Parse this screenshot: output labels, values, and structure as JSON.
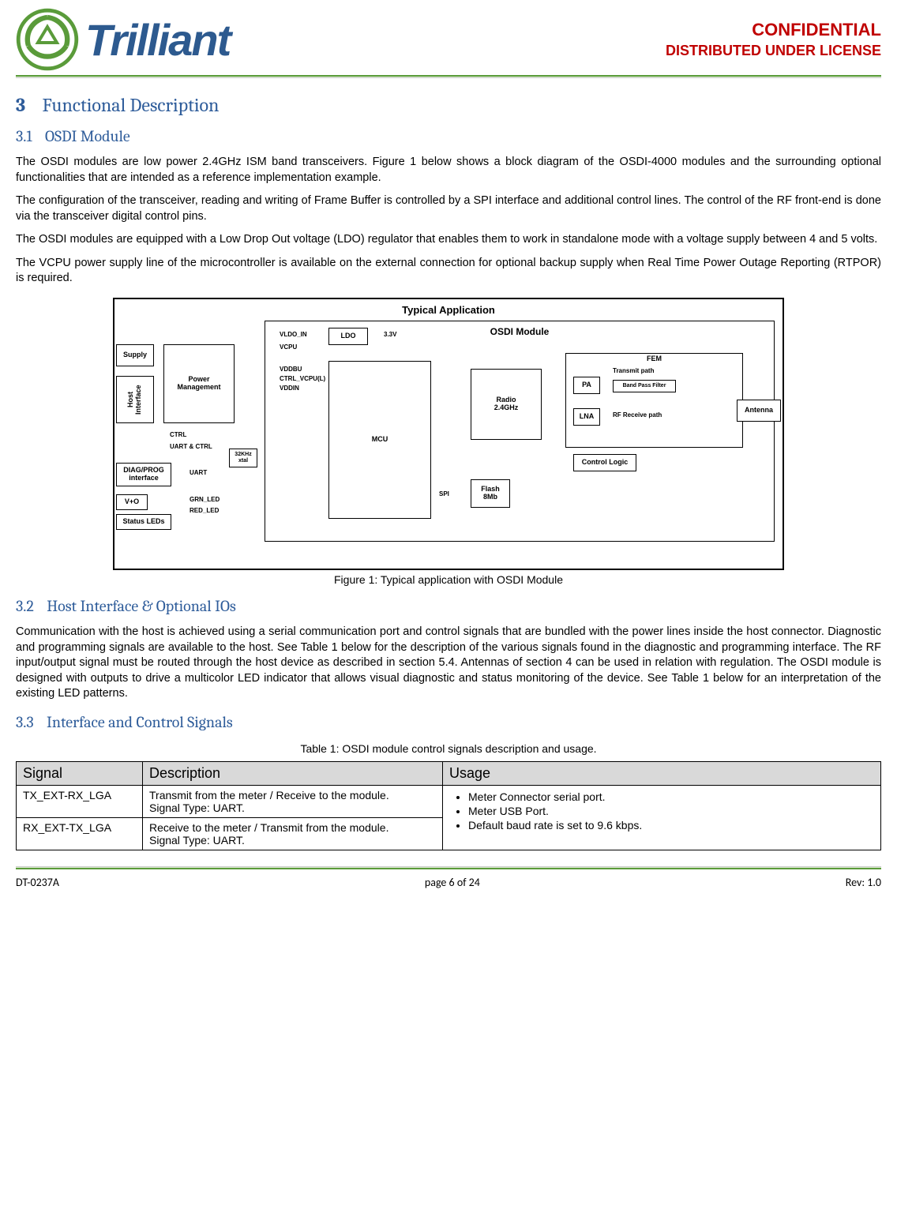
{
  "header": {
    "logo_text": "Trilliant",
    "classification_line1": "CONFIDENTIAL",
    "classification_line2": "DISTRIBUTED UNDER LICENSE"
  },
  "section3": {
    "num": "3",
    "title": "Functional Description"
  },
  "section3_1": {
    "num": "3.1",
    "title": "OSDI Module",
    "para1": "The OSDI modules are low power 2.4GHz ISM band transceivers. Figure 1 below shows a block diagram of the OSDI-4000 modules and the surrounding optional functionalities that are intended as a reference implementation example.",
    "para2": "The configuration of the transceiver, reading and writing of Frame Buffer is controlled by a SPI interface and additional control lines. The control of the RF front-end is done via the transceiver digital control pins.",
    "para3": "The OSDI modules are equipped with a Low Drop Out voltage (LDO) regulator that enables them to work in standalone mode with a voltage supply between 4 and 5 volts.",
    "para4": "The VCPU power supply line of the microcontroller is available on the external connection for optional backup supply when Real Time Power Outage Reporting (RTPOR) is required."
  },
  "figure1": {
    "outer_title": "Typical Application",
    "inner_title": "OSDI Module",
    "caption": "Figure 1: Typical application with OSDI Module",
    "blocks": {
      "supply": "Supply",
      "host_if": "Host Interface",
      "pm": "Power\nManagement",
      "diag": "DIAG/PROG\ninterface",
      "vplus": "V+O",
      "leds": "Status LEDs",
      "ldo": "LDO",
      "mcu": "MCU",
      "xtal": "32KHz\nxtal",
      "radio": "Radio\n2.4GHz",
      "flash": "Flash\n8Mb",
      "fem": "FEM",
      "pa": "PA",
      "lna": "LNA",
      "ctrl_logic": "Control Logic",
      "bpf": "Band Pass Filter",
      "tx_path": "Transmit path",
      "rx_path": "RF Receive path",
      "antenna": "Antenna"
    },
    "labels": {
      "vldo_in": "VLDO_IN",
      "vcpu": "VCPU",
      "vddbu": "VDDBU",
      "ctrl_vcpu": "CTRL_VCPU(L)",
      "vddin": "VDDIN",
      "ctrl": "CTRL",
      "uart_ctrl": "UART & CTRL",
      "uart": "UART",
      "grn": "GRN_LED",
      "red": "RED_LED",
      "spi": "SPI",
      "v3_3": "3.3V"
    }
  },
  "section3_2": {
    "num": "3.2",
    "title": "Host Interface & Optional IOs",
    "para1": "Communication with the host is achieved using a serial communication port and control signals that are bundled with the power lines inside the host connector. Diagnostic and programming signals are available to the host.  See Table 1 below for the description of the various signals found in the diagnostic and programming interface.  The RF input/output signal must be routed through the host device as described in section 5.4.  Antennas of section 4 can be used in relation with regulation.   The OSDI module is designed with outputs to drive a multicolor LED indicator that allows visual diagnostic and status monitoring of the device. See Table 1 below for an interpretation of the existing LED patterns."
  },
  "section3_3": {
    "num": "3.3",
    "title": "Interface and Control Signals"
  },
  "table1": {
    "caption": "Table 1: OSDI module control signals description and usage.",
    "headers": {
      "c1": "Signal",
      "c2": "Description",
      "c3": "Usage"
    },
    "rows": [
      {
        "signal": "TX_EXT-RX_LGA",
        "desc": "Transmit from the meter / Receive to the module.\nSignal Type: UART."
      },
      {
        "signal": "RX_EXT-TX_LGA",
        "desc": "Receive to the meter / Transmit from the module.\nSignal Type: UART."
      }
    ],
    "usage_bullets": [
      "Meter Connector serial port.",
      "Meter USB Port.",
      "Default baud rate is set to 9.6 kbps."
    ]
  },
  "footer": {
    "left": "DT-0237A",
    "center": "page 6 of 24",
    "right": "Rev: 1.0"
  }
}
